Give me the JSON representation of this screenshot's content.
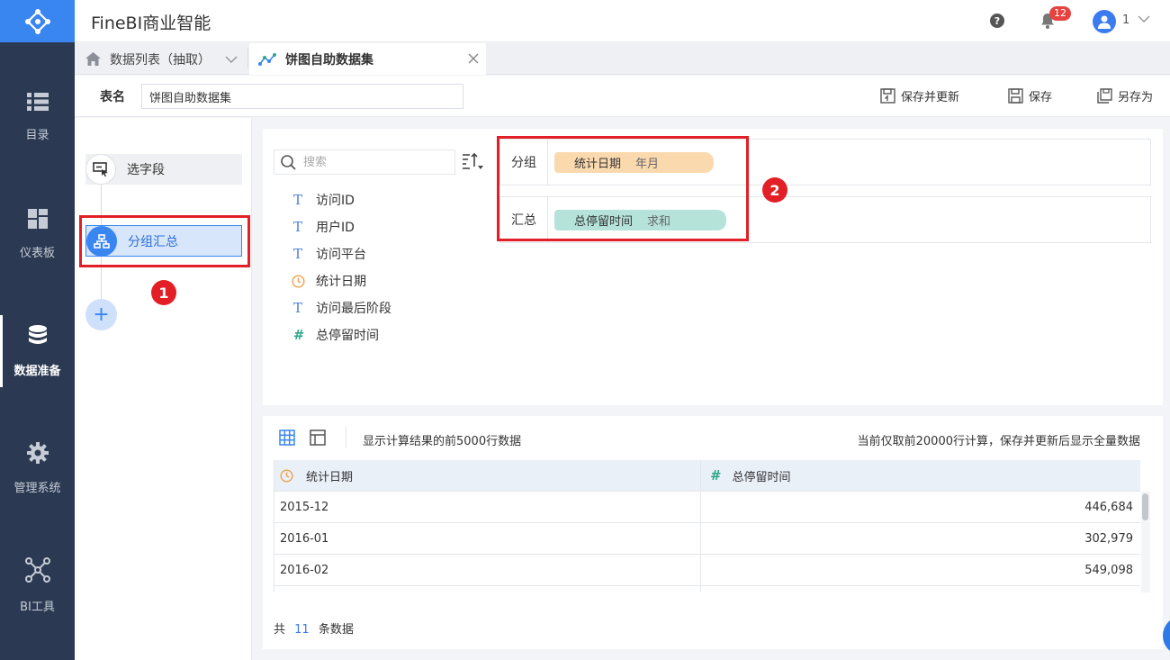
{
  "app": {
    "title": "FineBI商业智能"
  },
  "nav": {
    "items": [
      {
        "label": "目录"
      },
      {
        "label": "仪表板"
      },
      {
        "label": "数据准备"
      },
      {
        "label": "管理系统"
      },
      {
        "label": "BI工具"
      }
    ],
    "active": "数据准备"
  },
  "header": {
    "help_glyph": "?",
    "notification_count": "12",
    "user_name": "1"
  },
  "tabs": [
    {
      "label": "数据列表（抽取）"
    },
    {
      "label": "饼图自助数据集"
    }
  ],
  "namebar": {
    "label": "表名",
    "value": "饼图自助数据集",
    "save_update": "保存并更新",
    "save": "保存",
    "save_as": "另存为"
  },
  "steps": [
    {
      "label": "选字段"
    },
    {
      "label": "分组汇总"
    }
  ],
  "annotations": {
    "marker1": "1",
    "marker2": "2"
  },
  "config": {
    "search_placeholder": "搜索",
    "fields": [
      {
        "type": "text",
        "label": "访问ID"
      },
      {
        "type": "text",
        "label": "用户ID"
      },
      {
        "type": "text",
        "label": "访问平台"
      },
      {
        "type": "date",
        "label": "统计日期"
      },
      {
        "type": "text",
        "label": "访问最后阶段"
      },
      {
        "type": "number",
        "label": "总停留时间"
      }
    ],
    "group": {
      "label": "分组",
      "field": "统计日期",
      "agg": "年月"
    },
    "summary": {
      "label": "汇总",
      "field": "总停留时间",
      "agg": "求和"
    }
  },
  "result": {
    "hint": "显示计算结果的前5000行数据",
    "note": "当前仅取前20000行计算，保存并更新后显示全量数据",
    "columns": [
      "统计日期",
      "总停留时间"
    ],
    "rows": [
      [
        "2015-12",
        "446,684"
      ],
      [
        "2016-01",
        "302,979"
      ],
      [
        "2016-02",
        "549,098"
      ]
    ],
    "count_prefix": "共",
    "count": "11",
    "count_suffix": "条数据"
  },
  "colors": {
    "nav_bg": "#2b3a52",
    "accent": "#3a86f0",
    "annotation_red": "#e21f26",
    "pill_group": "#fbd9ae",
    "pill_summary": "#b5e3da"
  }
}
